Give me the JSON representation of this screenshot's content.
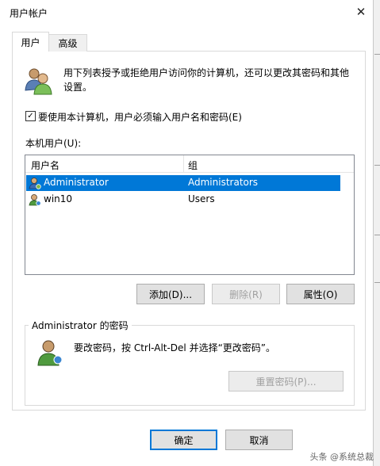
{
  "window": {
    "title": "用户帐户",
    "close_glyph": "✕"
  },
  "tabs": [
    {
      "label": "用户",
      "active": true
    },
    {
      "label": "高级",
      "active": false
    }
  ],
  "description": "用下列表授予或拒绝用户访问你的计算机，还可以更改其密码和其他设置。",
  "require_login": {
    "checked": true,
    "check_glyph": "✓",
    "label": "要使用本计算机，用户必须输入用户名和密码(E)"
  },
  "user_list": {
    "label": "本机用户(U):",
    "columns": [
      "用户名",
      "组"
    ],
    "rows": [
      {
        "name": "Administrator",
        "group": "Administrators",
        "selected": true
      },
      {
        "name": "win10",
        "group": "Users",
        "selected": false
      }
    ]
  },
  "list_buttons": {
    "add": "添加(D)...",
    "remove": "删除(R)",
    "properties": "属性(O)"
  },
  "password_group": {
    "title": "Administrator 的密码",
    "text": "要改密码，按 Ctrl-Alt-Del 并选择“更改密码”。",
    "reset_button": "重置密码(P)..."
  },
  "dialog_buttons": {
    "ok": "确定",
    "cancel": "取消"
  },
  "watermark": "头条 @系统总裁",
  "colors": {
    "selection": "#0078d7",
    "accent": "#0078d7"
  }
}
